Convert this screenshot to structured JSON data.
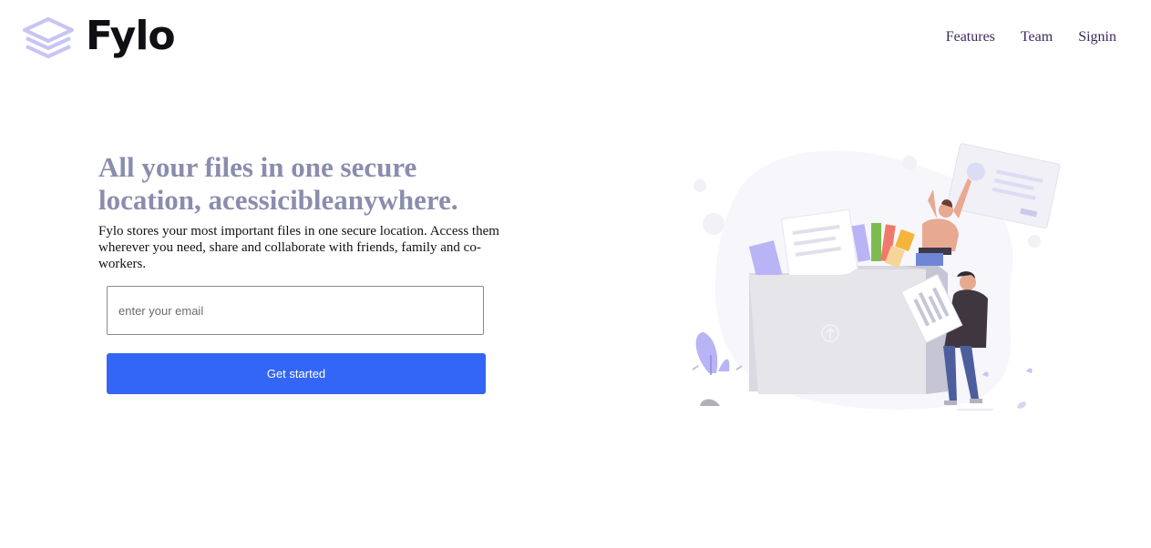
{
  "brand": {
    "name": "Fylo",
    "logo_icon": "stacked-layers-icon",
    "logo_color": "#c7c4f5"
  },
  "nav": {
    "items": [
      "Features",
      "Team",
      "Signin"
    ]
  },
  "hero": {
    "headline": "All your files in one secure location, acessicibleanywhere.",
    "description": "Fylo stores your most important files in one secure location. Access them wherever you need, share and collaborate with friends, family and co-workers.",
    "email_placeholder": "enter your email",
    "cta_label": "Get started",
    "headline_color": "#8a8dad",
    "cta_color": "#3366f6"
  },
  "illustration": {
    "name": "file-collaboration-illustration",
    "colors": [
      "#b8b4f5",
      "#7dbb52",
      "#f07a6a",
      "#f5b43c",
      "#f7d49a",
      "#e5e5ea"
    ]
  }
}
